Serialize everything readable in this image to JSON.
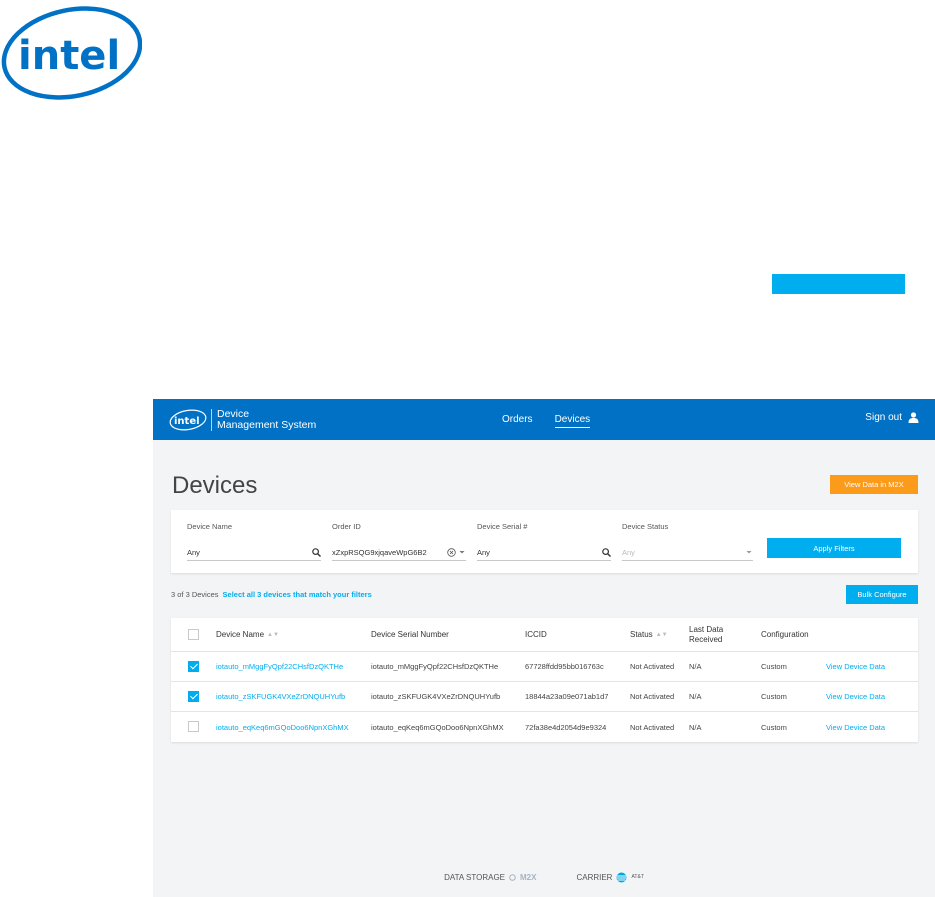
{
  "outer": {
    "logo_text": "intel"
  },
  "header": {
    "logo_text": "intel",
    "brand_line1": "Device",
    "brand_line2": "Management System",
    "nav": [
      {
        "label": "Orders",
        "active": false
      },
      {
        "label": "Devices",
        "active": true
      }
    ],
    "signout_label": "Sign out",
    "accent": "#0071c5"
  },
  "page": {
    "title": "Devices",
    "m2x_button": "View Data in M2X",
    "m2x_color": "#fc9a1a"
  },
  "filters": {
    "device_name": {
      "label": "Device Name",
      "value": "Any"
    },
    "order_id": {
      "label": "Order ID",
      "value": "xZxpRSQG9xjqaveWpG6B2"
    },
    "serial": {
      "label": "Device Serial #",
      "value": "Any"
    },
    "status": {
      "label": "Device Status",
      "value": "Any"
    },
    "apply_label": "Apply Filters"
  },
  "summary": {
    "count_text": "3 of 3 Devices",
    "select_all_link": "Select all 3 devices that match your filters",
    "bulk_button": "Bulk Configure"
  },
  "table": {
    "headers": {
      "device_name": "Device Name",
      "serial": "Device Serial Number",
      "iccid": "ICCID",
      "status": "Status",
      "last_data_1": "Last Data",
      "last_data_2": "Received",
      "configuration": "Configuration"
    },
    "rows": [
      {
        "checked": true,
        "name": "iotauto_mMggFyQpf22CHsfDzQKTHe",
        "serial": "iotauto_mMggFyQpf22CHsfDzQKTHe",
        "iccid": "67728ffdd95bb016763c",
        "status": "Not Activated",
        "last_data": "N/A",
        "configuration": "Custom",
        "action": "View Device Data"
      },
      {
        "checked": true,
        "name": "iotauto_zSKFUGK4VXeZrDNQUHYufb",
        "serial": "iotauto_zSKFUGK4VXeZrDNQUHYufb",
        "iccid": "18844a23a09e071ab1d7",
        "status": "Not Activated",
        "last_data": "N/A",
        "configuration": "Custom",
        "action": "View Device Data"
      },
      {
        "checked": false,
        "name": "iotauto_eqKeq6mGQoDoo6NpnXGhMX",
        "serial": "iotauto_eqKeq6mGQoDoo6NpnXGhMX",
        "iccid": "72fa38e4d2054d9e9324",
        "status": "Not Activated",
        "last_data": "N/A",
        "configuration": "Custom",
        "action": "View Device Data"
      }
    ]
  },
  "footer": {
    "storage_label": "DATA STORAGE",
    "storage_brand": "M2X",
    "carrier_label": "CARRIER",
    "carrier_brand": "AT&T"
  }
}
